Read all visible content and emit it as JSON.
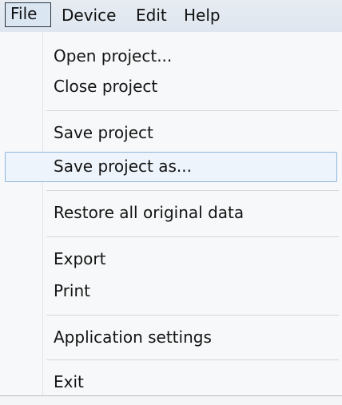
{
  "menubar": {
    "items": [
      {
        "label": "File"
      },
      {
        "label": "Device"
      },
      {
        "label": "Edit"
      },
      {
        "label": "Help"
      }
    ]
  },
  "file_menu": {
    "items": [
      {
        "label": "Open project..."
      },
      {
        "label": "Close project"
      },
      {
        "label": "Save project"
      },
      {
        "label": "Save project as..."
      },
      {
        "label": "Restore all original data"
      },
      {
        "label": "Export"
      },
      {
        "label": "Print"
      },
      {
        "label": "Application settings"
      },
      {
        "label": "Exit"
      }
    ],
    "highlighted_item": "Save project as..."
  }
}
